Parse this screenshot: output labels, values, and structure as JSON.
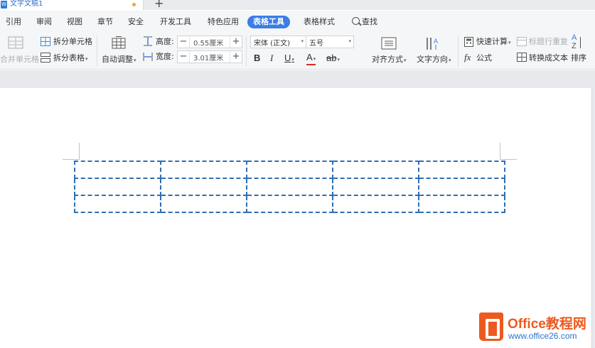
{
  "doc_tab": {
    "title": "文字文稿1",
    "new_tab": "+"
  },
  "menu": {
    "items": [
      "引用",
      "审阅",
      "视图",
      "章节",
      "安全",
      "开发工具",
      "特色应用",
      "表格工具",
      "表格样式"
    ],
    "active": "表格工具",
    "search_label": "查找"
  },
  "ribbon": {
    "merge_cells": "合并单元格",
    "split_cells": "拆分单元格",
    "split_table": "拆分表格",
    "auto_fit": "自动调整",
    "height_label": "高度:",
    "height_value": "0.55厘米",
    "width_label": "宽度:",
    "width_value": "3.01厘米",
    "font_name": "宋体 (正文)",
    "font_size": "五号",
    "bold": "B",
    "italic": "I",
    "underline": "U",
    "font_color": "A",
    "highlight": "ab",
    "align": "对齐方式",
    "text_direction": "文字方向",
    "quick_calc": "快速计算",
    "formula_prefix": "fx",
    "formula": "公式",
    "header_repeat": "标题行重复",
    "convert_text": "转换成文本",
    "sort": "排序",
    "sort_icon_top": "A",
    "sort_icon_bottom": "Z"
  },
  "table": {
    "rows": 3,
    "cols": 5,
    "border_color": "#2f6fb4"
  },
  "watermark": {
    "title": "Office教程网",
    "url": "www.office26.com"
  },
  "colors": {
    "accent": "#3c7de6",
    "brand_orange": "#ec5a1f",
    "font_color_red": "#d92b2b"
  }
}
